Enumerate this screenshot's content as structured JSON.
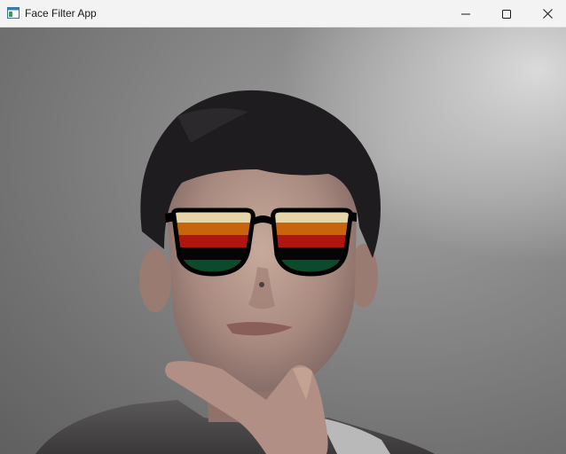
{
  "window": {
    "title": "Face Filter App",
    "icons": {
      "app": "app-window-icon",
      "minimize": "minimize-icon",
      "maximize": "maximize-icon",
      "close": "close-icon"
    }
  },
  "camera_feed": {
    "overlay": "sunglasses",
    "lens_stripe_colors": [
      "#e6d5a8",
      "#c8640c",
      "#b0150f",
      "#050505",
      "#0b4a2a"
    ],
    "frame_color": "#000000"
  }
}
